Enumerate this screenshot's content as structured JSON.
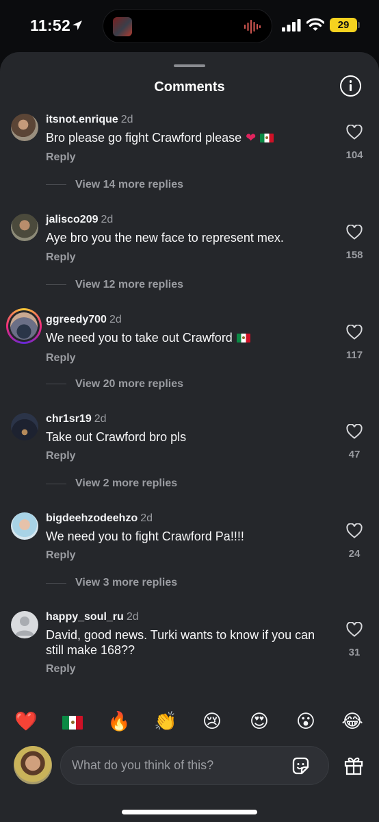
{
  "status_bar": {
    "time": "11:52",
    "battery": "29",
    "icons": [
      "location-arrow-icon",
      "signal-icon",
      "wifi-icon",
      "battery-icon"
    ]
  },
  "sheet": {
    "title": "Comments",
    "info_icon": "info-icon"
  },
  "comments": [
    {
      "user": "itsnot.enrique",
      "age": "2d",
      "text": "Bro please go fight Crawford please",
      "emoji": [
        "red-heart",
        "mexico-flag"
      ],
      "reply": "Reply",
      "likes": "104",
      "more": "View 14 more replies"
    },
    {
      "user": "jalisco209",
      "age": "2d",
      "text": "Aye bro you the new face to represent mex.",
      "emoji": [],
      "reply": "Reply",
      "likes": "158",
      "more": "View 12 more replies"
    },
    {
      "user": "ggreedy700",
      "age": "2d",
      "text": "We need you to take out Crawford",
      "emoji": [
        "mexico-flag"
      ],
      "reply": "Reply",
      "likes": "117",
      "more": "View 20 more replies"
    },
    {
      "user": "chr1sr19",
      "age": "2d",
      "text": "Take out Crawford bro pls",
      "emoji": [],
      "reply": "Reply",
      "likes": "47",
      "more": "View 2 more replies"
    },
    {
      "user": "bigdeehzodeehzo",
      "age": "2d",
      "text": "We need you to fight Crawford Pa!!!!",
      "emoji": [],
      "reply": "Reply",
      "likes": "24",
      "more": "View 3 more replies"
    },
    {
      "user": "happy_soul_ru",
      "age": "2d",
      "text": "David, good news. Turki wants to know if you can still make 168??",
      "emoji": [],
      "reply": "Reply",
      "likes": "31",
      "more": ""
    }
  ],
  "emoji_bar": {
    "items": [
      "❤️",
      "🇲🇽",
      "🔥",
      "👏",
      "😢",
      "😍",
      "😮",
      "😂"
    ]
  },
  "composer": {
    "placeholder": "What do you think of this?",
    "sticker_icon": "sticker-icon",
    "gift_icon": "gift-icon"
  },
  "colors": {
    "sheet_bg": "#25272b",
    "text_primary": "#f2f3f5",
    "text_secondary": "#9a9ca1",
    "battery": "#f5d21f",
    "like_heart": "#e0245e"
  }
}
